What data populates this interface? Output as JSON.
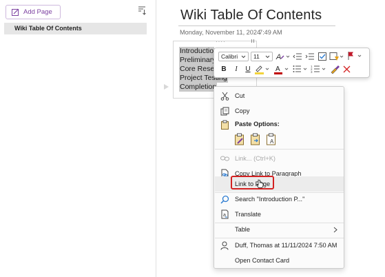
{
  "left_pane": {
    "add_page_label": "Add Page",
    "pages": [
      {
        "title": "Wiki Table Of Contents",
        "selected": true
      }
    ]
  },
  "page": {
    "title": "Wiki Table Of Contents",
    "date": "Monday, November 11, 2024",
    "time": "7:49 AM",
    "lines": [
      "Introductio",
      "Preliminary",
      "Core Resea",
      "Project Testing",
      "Completion"
    ]
  },
  "mini_toolbar": {
    "font_name": "Calibri",
    "font_size": "11",
    "bold_label": "B",
    "italic_label": "I",
    "underline_label": "U"
  },
  "context_menu": {
    "cut": "Cut",
    "copy": "Copy",
    "paste_options": "Paste Options:",
    "link": "Link...  (Ctrl+K)",
    "copy_link_paragraph": "Copy Link to Paragraph",
    "link_to_page": "Link to Page",
    "search": "Search \"Introduction P...\"",
    "translate": "Translate",
    "table": "Table",
    "author": "Duff, Thomas at 11/11/2024 7:50 AM",
    "open_contact_card": "Open Contact Card"
  },
  "colors": {
    "accent_purple": "#7b3fa0",
    "highlight_yellow": "#f2d33b",
    "font_color_red": "#c00000",
    "flag_red": "#c0182a",
    "focus_ring_red": "#d32121",
    "selection_gray": "#c9c9c9"
  },
  "icons": {
    "add_page": "add-page-icon",
    "sort": "sort-icon",
    "cut": "scissors-icon",
    "copy": "copy-icon",
    "paste": "clipboard-icon",
    "link": "link-icon",
    "copy_link": "copy-link-icon",
    "search": "search-icon",
    "translate": "translate-icon",
    "author": "person-icon"
  }
}
